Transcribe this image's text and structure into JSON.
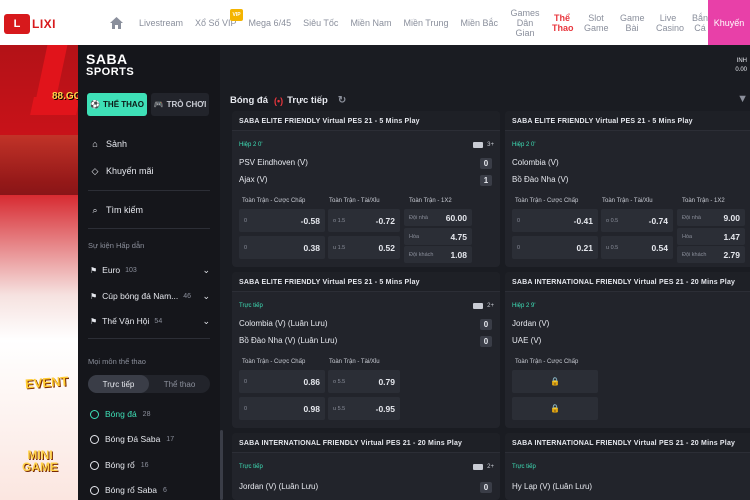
{
  "brand": {
    "logo_text": "LIXI",
    "logo_sub": "CHOI GAME",
    "domain_badge": "88.GG"
  },
  "nav": {
    "items": [
      "Livestream",
      "Xổ Số VIP",
      "Mega 6/45",
      "Siêu Tốc",
      "Miền Nam",
      "Miền Trung",
      "Miền Bắc",
      "Games Dân Gian",
      "Thể Thao",
      "Slot Game",
      "Game Bài",
      "Live Casino",
      "Bắn Cá"
    ],
    "vip_badge": "VIP",
    "promo": "Khuyến"
  },
  "saba": {
    "logo_line1": "SABA",
    "logo_line2": "SPORTS"
  },
  "account": {
    "line1": "INH",
    "line2": "0.00"
  },
  "sidebar": {
    "tab_sport": "THỂ THAO",
    "tab_game": "TRÒ CHƠI",
    "lobby": "Sảnh",
    "promo": "Khuyến mãi",
    "search": "Tìm kiếm",
    "featured_heading": "Sự kiện Hấp dẫn",
    "featured": [
      {
        "label": "Euro",
        "count": "103"
      },
      {
        "label": "Cúp bóng đá Nam...",
        "count": "46"
      },
      {
        "label": "Thế Vận Hội",
        "count": "54"
      }
    ],
    "all_sports_heading": "Mọi môn thể thao",
    "toggle_live": "Trực tiếp",
    "toggle_pre": "Thể thao",
    "sports": [
      {
        "label": "Bóng đá",
        "count": "28"
      },
      {
        "label": "Bóng Đá Saba",
        "count": "17"
      },
      {
        "label": "Bóng rổ",
        "count": "16"
      },
      {
        "label": "Bóng rổ Saba",
        "count": "6"
      }
    ]
  },
  "main": {
    "title": "Bóng đá",
    "live_label": "Trực tiếp"
  },
  "cards": [
    {
      "title": "SABA ELITE FRIENDLY Virtual PES 21 - 5 Mins Play",
      "status": "Hiệp 2 0'",
      "badge": "3+",
      "home": "PSV Eindhoven (V)",
      "home_score": "0",
      "away": "Ajax (V)",
      "away_score": "1",
      "hdp_head": "Toàn Trận - Cược Chấp",
      "ou_head": "Toàn Trận - Tài/Xỉu",
      "x12_head": "Toàn Trận - 1X2",
      "hdp": [
        {
          "line": "0",
          "odds": "-0.58"
        },
        {
          "line": "0",
          "odds": "0.38"
        }
      ],
      "ou": [
        {
          "line": "o 1.5",
          "odds": "-0.72"
        },
        {
          "line": "u 1.5",
          "odds": "0.52"
        }
      ],
      "x12": [
        {
          "line": "Đội nhà",
          "odds": "60.00"
        },
        {
          "line": "Hòa",
          "odds": "4.75"
        },
        {
          "line": "Đội khách",
          "odds": "1.08"
        }
      ]
    },
    {
      "title": "SABA ELITE FRIENDLY Virtual PES 21 - 5 Mins Play",
      "status": "Hiệp 2 0'",
      "badge": "",
      "home": "Colombia (V)",
      "home_score": "",
      "away": "Bồ Đào Nha (V)",
      "away_score": "",
      "hdp_head": "Toàn Trận - Cược Chấp",
      "ou_head": "Toàn Trận - Tài/Xỉu",
      "x12_head": "Toàn Trận - 1X2",
      "hdp": [
        {
          "line": "0",
          "odds": "-0.41"
        },
        {
          "line": "0",
          "odds": "0.21"
        }
      ],
      "ou": [
        {
          "line": "o 0.5",
          "odds": "-0.74"
        },
        {
          "line": "u 0.5",
          "odds": "0.54"
        }
      ],
      "x12": [
        {
          "line": "Đội nhà",
          "odds": "9.00"
        },
        {
          "line": "Hòa",
          "odds": "1.47"
        },
        {
          "line": "Đội khách",
          "odds": "2.79"
        }
      ]
    },
    {
      "title": "SABA ELITE FRIENDLY Virtual PES 21 - 5 Mins Play",
      "status": "Trực tiếp",
      "badge": "2+",
      "home": "Colombia (V) (Luân Lưu)",
      "home_score": "0",
      "away": "Bồ Đào Nha (V) (Luân Lưu)",
      "away_score": "0",
      "hdp_head": "Toàn Trận - Cược Chấp",
      "ou_head": "Toàn Trận - Tài/Xỉu",
      "hdp": [
        {
          "line": "0",
          "odds": "0.86"
        },
        {
          "line": "0",
          "odds": "0.98"
        }
      ],
      "ou": [
        {
          "line": "o 5.5",
          "odds": "0.79"
        },
        {
          "line": "u 5.5",
          "odds": "-0.95"
        }
      ]
    },
    {
      "title": "SABA INTERNATIONAL FRIENDLY Virtual PES 21 - 20 Mins Play",
      "status": "Hiệp 2 9'",
      "badge": "",
      "home": "Jordan (V)",
      "home_score": "",
      "away": "UAE (V)",
      "away_score": "",
      "hdp_head": "Toàn Trận - Cược Chấp"
    },
    {
      "title": "SABA INTERNATIONAL FRIENDLY Virtual PES 21 - 20 Mins Play",
      "status": "Trực tiếp",
      "badge": "2+",
      "home": "Jordan (V) (Luân Lưu)",
      "home_score": "0"
    },
    {
      "title": "SABA INTERNATIONAL FRIENDLY Virtual PES 21 - 20 Mins Play",
      "status": "Trực tiếp",
      "badge": "",
      "home": "Hy Lạp (V) (Luân Lưu)",
      "home_score": "0"
    }
  ],
  "colors": {
    "accent": "#3ee0b7",
    "live": "#e8363d",
    "brand": "#d7191c",
    "promo": "#e840a8"
  }
}
